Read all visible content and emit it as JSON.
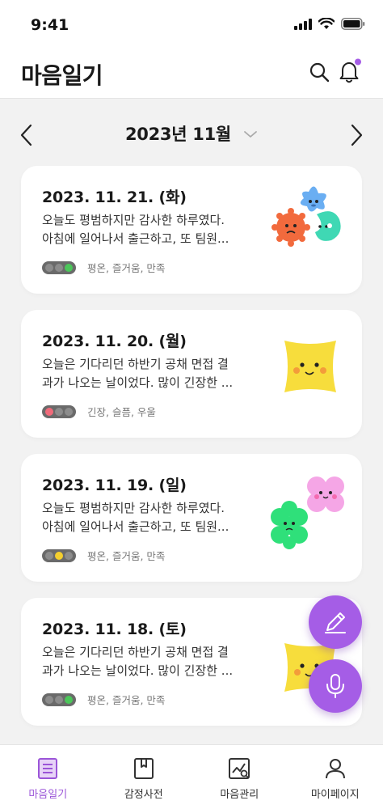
{
  "status_bar": {
    "time": "9:41"
  },
  "header": {
    "title": "마음일기"
  },
  "month_nav": {
    "label": "2023년 11월"
  },
  "colors": {
    "accent": "#a55de6",
    "accent_text": "#9b55d8",
    "notification_dot": "#a55de6",
    "traffic_body": "#6a6a6a",
    "traffic_off": "#8c8c8c",
    "traffic_green": "#4cc65a",
    "traffic_yellow": "#f5cf2e",
    "traffic_red": "#f06a7a"
  },
  "entries": [
    {
      "date": "2023. 11. 21. (화)",
      "line1": "오늘도 평범하지만 감사한 하루였다.",
      "line2": "아침에 일어나서 출근하고, 또 팀원...",
      "moods": "평온, 즐거움, 만족",
      "traffic_light": "green",
      "art": "blue-star, orange-burst, teal-blob"
    },
    {
      "date": "2023. 11. 20. (월)",
      "line1": "오늘은 기다리던 하반기 공채 면접 결",
      "line2": "과가 나오는 날이었다. 많이 긴장한 ...",
      "moods": "긴장, 슬픔, 우울",
      "traffic_light": "red",
      "art": "yellow-square"
    },
    {
      "date": "2023. 11. 19. (일)",
      "line1": "오늘도 평범하지만 감사한 하루였다.",
      "line2": "아침에 일어나서 출근하고, 또 팀원...",
      "moods": "평온, 즐거움, 만족",
      "traffic_light": "yellow",
      "art": "pink-clover, green-clover"
    },
    {
      "date": "2023. 11. 18. (토)",
      "line1": "오늘은 기다리던 하반기 공채 면접 결",
      "line2": "과가 나오는 날이었다. 많이 긴장한 ...",
      "moods": "평온, 즐거움, 만족",
      "traffic_light": "green",
      "art": "yellow-square"
    }
  ],
  "fab": {
    "write_icon": "pencil-icon",
    "voice_icon": "microphone-icon"
  },
  "bottom_nav": [
    {
      "label": "마음일기",
      "icon": "diary-icon",
      "active": true
    },
    {
      "label": "감정사전",
      "icon": "book-icon",
      "active": false
    },
    {
      "label": "마음관리",
      "icon": "chart-icon",
      "active": false
    },
    {
      "label": "마이페이지",
      "icon": "user-icon",
      "active": false
    }
  ]
}
